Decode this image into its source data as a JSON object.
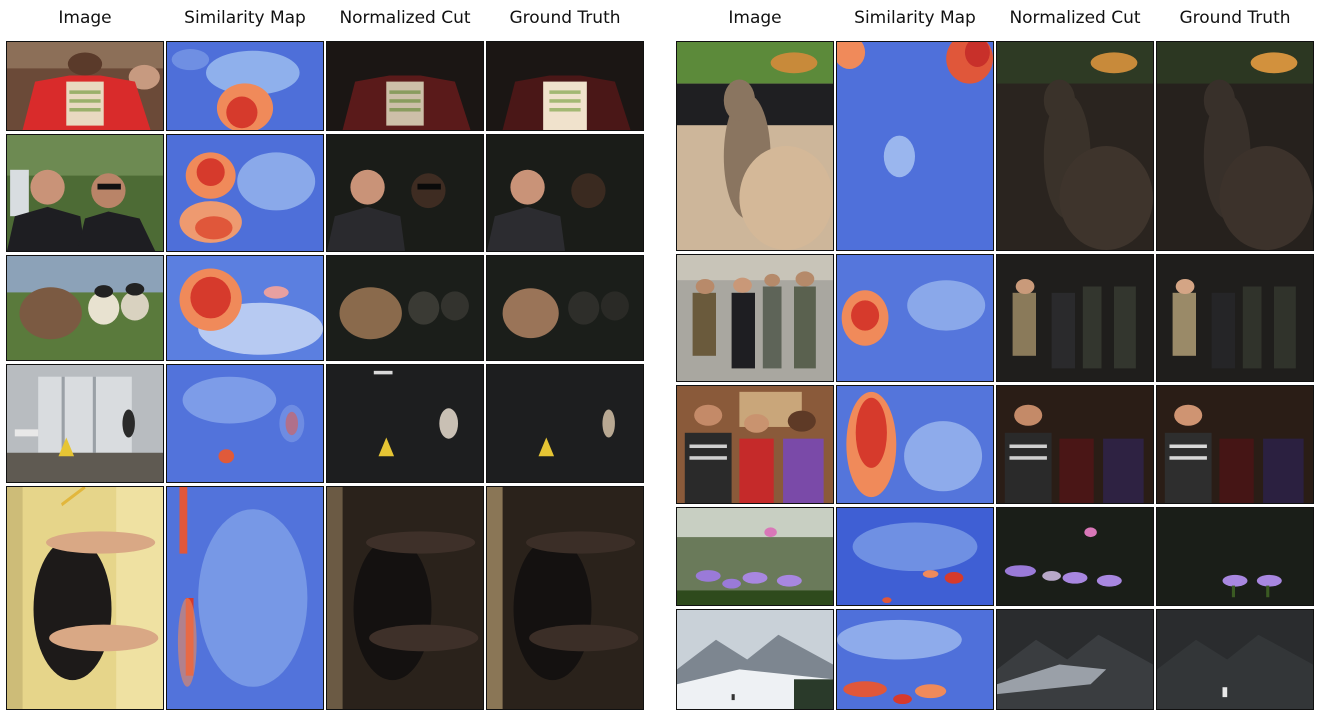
{
  "columns": [
    "Image",
    "Similarity Map",
    "Normalized Cut",
    "Ground Truth"
  ],
  "left_panel": {
    "rows": [
      {
        "subject": "football coach in red jacket holding play chart"
      },
      {
        "subject": "two smiling men near waterfall"
      },
      {
        "subject": "football players with wombat"
      },
      {
        "subject": "restroom with wet floor sign and janitor"
      },
      {
        "subject": "black dog being measured against wall ruler"
      }
    ]
  },
  "right_panel": {
    "rows": [
      {
        "subject": "kitten in car looking out window at bird"
      },
      {
        "subject": "officials in winter hats with rifle"
      },
      {
        "subject": "three people posing in front of window"
      },
      {
        "subject": "purple water lilies in pond"
      },
      {
        "subject": "snowy mountains with skier"
      }
    ]
  }
}
